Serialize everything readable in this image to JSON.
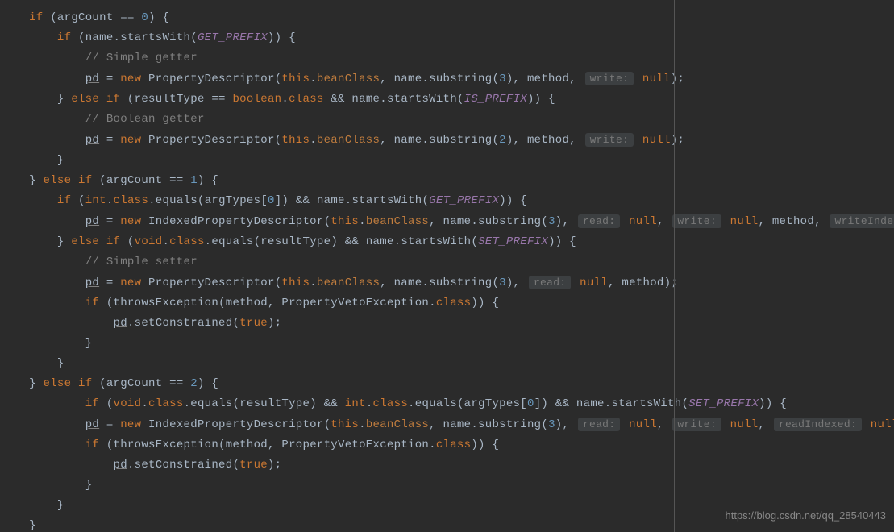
{
  "watermark": "https://blog.csdn.net/qq_28540443",
  "tokens": {
    "if": "if",
    "else": "else",
    "new": "new",
    "this": "this",
    "boolean": "boolean",
    "class": "class",
    "void": "void",
    "int": "int",
    "true": "true",
    "null": "null"
  },
  "identifiers": {
    "argCount": "argCount",
    "name": "name",
    "startsWith": "startsWith",
    "GET_PREFIX": "GET_PREFIX",
    "IS_PREFIX": "IS_PREFIX",
    "SET_PREFIX": "SET_PREFIX",
    "pd": "pd",
    "PropertyDescriptor": "PropertyDescriptor",
    "IndexedPropertyDescriptor": "IndexedPropertyDescriptor",
    "beanClass": "beanClass",
    "substring": "substring",
    "method": "method",
    "resultType": "resultType",
    "equals": "equals",
    "argTypes": "argTypes",
    "throwsException": "throwsException",
    "PropertyVetoException": "PropertyVetoException",
    "setConstrained": "setConstrained"
  },
  "comments": {
    "simpleGetter": "// Simple getter",
    "booleanGetter": "// Boolean getter",
    "simpleSetter": "// Simple setter"
  },
  "hints": {
    "write": "write:",
    "read": "read:",
    "writeIndexed": "writeIndexed:",
    "readIndexed": "readIndexed:"
  },
  "numbers": {
    "n0": "0",
    "n1": "1",
    "n2": "2",
    "n3": "3"
  }
}
